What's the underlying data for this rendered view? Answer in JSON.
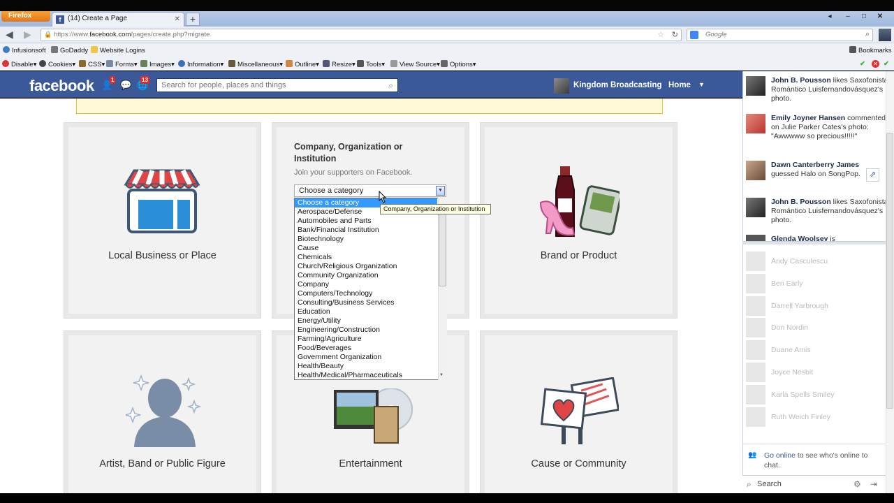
{
  "browser": {
    "firefox_label": "Firefox",
    "tab_title": "(14) Create a Page",
    "url_prefix": "https://www.",
    "url_domain": "facebook.com",
    "url_path": "/pages/create.php?migrate",
    "search_placeholder": "Google"
  },
  "bookmarks": [
    "Infusionsoft",
    "GoDaddy",
    "Website Logins",
    "Bookmarks"
  ],
  "toolbar": [
    "Disable",
    "Cookies",
    "CSS",
    "Forms",
    "Images",
    "Information",
    "Miscellaneous",
    "Outline",
    "Resize",
    "Tools",
    "View Source",
    "Options"
  ],
  "facebook": {
    "logo": "facebook",
    "friend_badge": "1",
    "notif_badge": "13",
    "search_placeholder": "Search for people, places and things",
    "profile_name": "Kingdom Broadcasting",
    "home": "Home"
  },
  "cards": [
    {
      "label": "Local Business or Place"
    },
    {
      "title": "Company, Organization or Institution",
      "subtitle": "Join your supporters on Facebook."
    },
    {
      "label": "Brand or Product"
    },
    {
      "label": "Artist, Band or Public Figure"
    },
    {
      "label": "Entertainment"
    },
    {
      "label": "Cause or Community"
    }
  ],
  "select": {
    "value": "Choose a category",
    "tooltip": "Company, Organization or Institution",
    "options": [
      "Choose a category",
      "Aerospace/Defense",
      "Automobiles and Parts",
      "Bank/Financial Institution",
      "Biotechnology",
      "Cause",
      "Chemicals",
      "Church/Religious Organization",
      "Community Organization",
      "Company",
      "Computers/Technology",
      "Consulting/Business Services",
      "Education",
      "Energy/Utility",
      "Engineering/Construction",
      "Farming/Agriculture",
      "Food/Beverages",
      "Government Organization",
      "Health/Beauty",
      "Health/Medical/Pharmaceuticals"
    ]
  },
  "ticker": [
    {
      "name": "John B. Pousson",
      "text": " likes Saxofonista Romántico Luisfernandovásquez's photo."
    },
    {
      "name": "Emily Joyner Hansen",
      "text": " commented on Julie Parker Cates's photo: \"Awwwww so precious!!!!!\""
    },
    {
      "name": "Dawn Canterberry James",
      "text": " guessed Halo on SongPop."
    },
    {
      "name": "John B. Pousson",
      "text": " likes Saxofonista Romántico Luisfernandovásquez's photo."
    },
    {
      "name": "Glenda Woolsey",
      "text": " is"
    }
  ],
  "chat_friends": [
    "Andy Casculescu",
    "Ben Early",
    "Darrell Yarbrough",
    "Don Nordin",
    "Duane Amis",
    "Joyce Nesbit",
    "Karla Spells Smiley",
    "Ruth Weich Finley"
  ],
  "chat": {
    "go_online": "Go online",
    "online_text": " to see who's online to chat.",
    "search": "Search"
  }
}
